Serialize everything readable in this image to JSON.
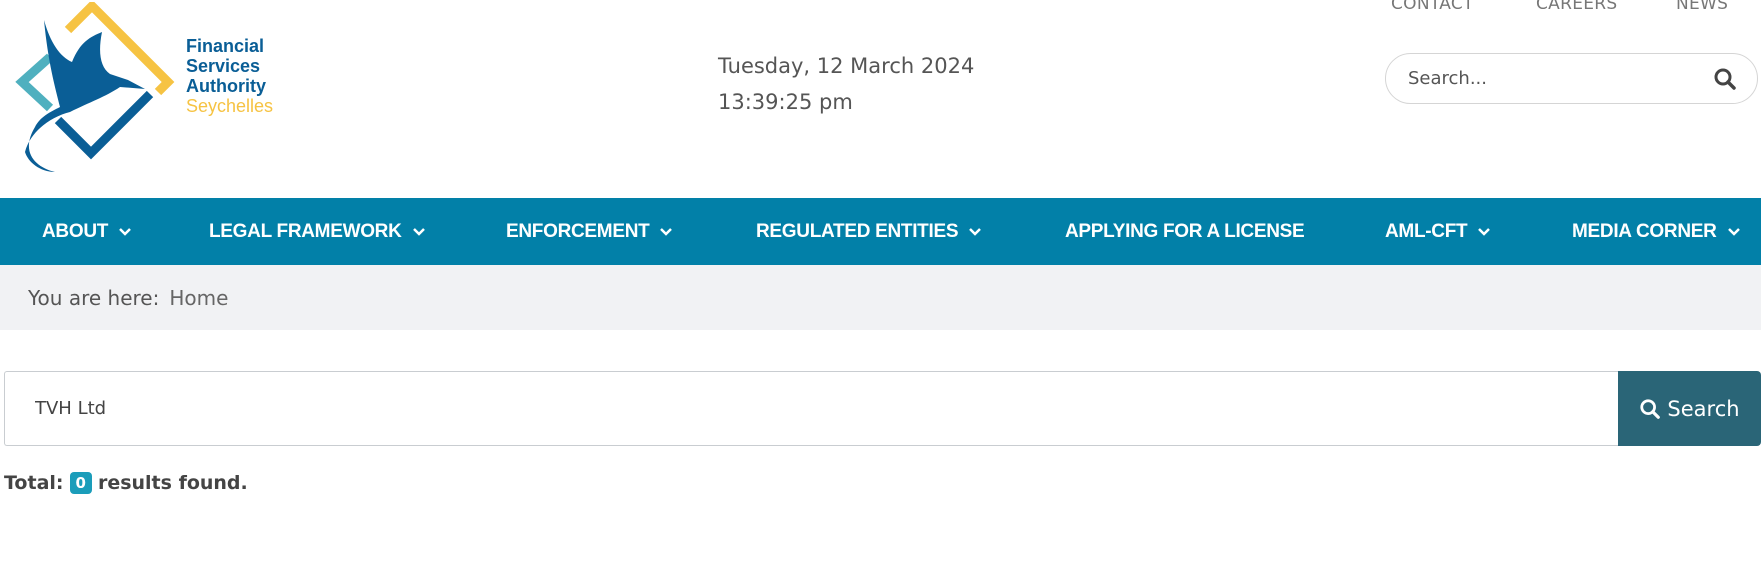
{
  "logo": {
    "line1": "Financial",
    "line2": "Services",
    "line3": "Authority",
    "line4": "Seychelles"
  },
  "datetime": {
    "date": "Tuesday, 12 March 2024",
    "time": "13:39:25 pm"
  },
  "top_links": [
    "CONTACT",
    "CAREERS",
    "NEWS"
  ],
  "header_search": {
    "placeholder": "Search...",
    "icon": "search-icon"
  },
  "nav": [
    {
      "label": "ABOUT",
      "dropdown": true
    },
    {
      "label": "LEGAL FRAMEWORK",
      "dropdown": true
    },
    {
      "label": "ENFORCEMENT",
      "dropdown": true
    },
    {
      "label": "REGULATED ENTITIES",
      "dropdown": true
    },
    {
      "label": "APPLYING FOR A LICENSE",
      "dropdown": false
    },
    {
      "label": "AML-CFT",
      "dropdown": true
    },
    {
      "label": "MEDIA CORNER",
      "dropdown": true
    }
  ],
  "breadcrumb": {
    "prefix": "You are here:",
    "current": "Home"
  },
  "search": {
    "value": "TVH Ltd",
    "button_label": "Search"
  },
  "results": {
    "prefix": "Total:",
    "count": "0",
    "suffix": "results found."
  },
  "colors": {
    "nav": "#0280a8",
    "button": "#2a6577",
    "badge": "#1b9dba",
    "logo_blue": "#0a5e96",
    "logo_yellow": "#f6c343",
    "logo_teal": "#4fb0bf"
  }
}
